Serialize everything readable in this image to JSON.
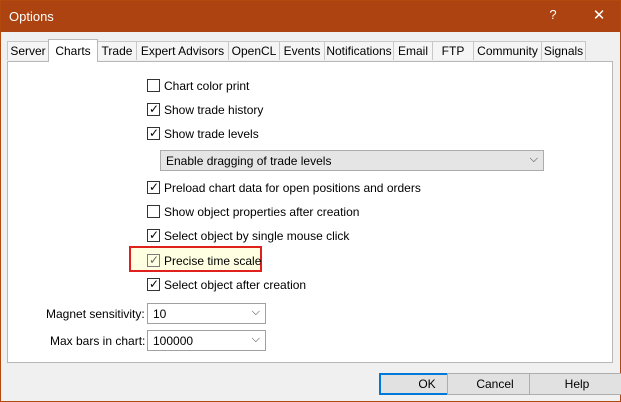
{
  "window": {
    "title": "Options",
    "help_glyph": "?",
    "close_glyph": "✕"
  },
  "tabs": [
    {
      "label": "Server",
      "active": false
    },
    {
      "label": "Charts",
      "active": true
    },
    {
      "label": "Trade",
      "active": false
    },
    {
      "label": "Expert Advisors",
      "active": false
    },
    {
      "label": "OpenCL",
      "active": false
    },
    {
      "label": "Events",
      "active": false
    },
    {
      "label": "Notifications",
      "active": false
    },
    {
      "label": "Email",
      "active": false
    },
    {
      "label": "FTP",
      "active": false
    },
    {
      "label": "Community",
      "active": false
    },
    {
      "label": "Signals",
      "active": false
    }
  ],
  "charts": {
    "chart_color_print": {
      "label": "Chart color print",
      "checked": false
    },
    "show_trade_history": {
      "label": "Show trade history",
      "checked": true
    },
    "show_trade_levels": {
      "label": "Show trade levels",
      "checked": true
    },
    "trade_levels_mode": {
      "value": "Enable dragging of trade levels",
      "arrow": "⌵"
    },
    "preload_chart_data": {
      "label": "Preload chart data for open positions and orders",
      "checked": true
    },
    "show_object_properties": {
      "label": "Show object properties after creation",
      "checked": false
    },
    "select_single_click": {
      "label": "Select object by single mouse click",
      "checked": true
    },
    "precise_time_scale": {
      "label": "Precise time scale",
      "checked": true
    },
    "select_after_creation": {
      "label": "Select object after creation",
      "checked": true
    },
    "magnet_sensitivity": {
      "label": "Magnet sensitivity:",
      "value": "10",
      "arrow": "⌵"
    },
    "max_bars": {
      "label": "Max bars in chart:",
      "value": "100000",
      "arrow": "⌵"
    },
    "check_glyph": "✓"
  },
  "buttons": {
    "ok": "OK",
    "cancel": "Cancel",
    "help": "Help"
  },
  "colors": {
    "titlebar": "#ad4311",
    "highlight_border": "#e0201c",
    "highlight_fill": "#ffffe1",
    "default_button_border": "#0078d7"
  }
}
